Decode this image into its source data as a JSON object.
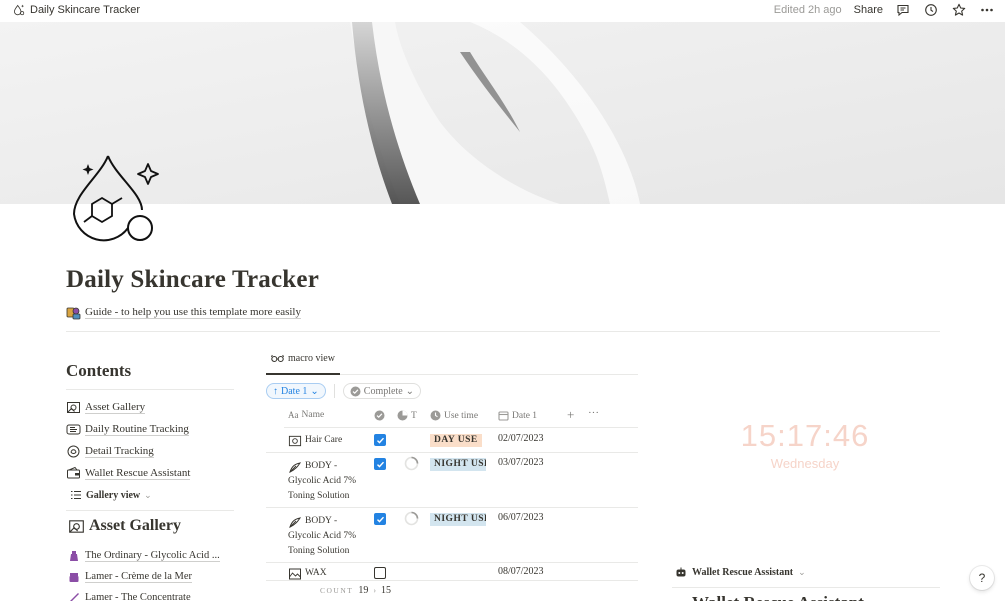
{
  "topbar": {
    "breadcrumb": "Daily Skincare Tracker",
    "edited": "Edited 2h ago",
    "share": "Share"
  },
  "page": {
    "title": "Daily Skincare Tracker",
    "guide": "Guide - to help you use this template more easily"
  },
  "contents": {
    "heading": "Contents",
    "items": [
      {
        "label": "Asset Gallery",
        "icon": "asset-gallery-icon"
      },
      {
        "label": "Daily Routine Tracking",
        "icon": "routine-icon"
      },
      {
        "label": "Detail Tracking",
        "icon": "detail-icon"
      },
      {
        "label": "Wallet Rescue Assistant",
        "icon": "wallet-icon"
      }
    ],
    "gallery_view": "Gallery view"
  },
  "asset_gallery": {
    "heading": "Asset Gallery",
    "items": [
      {
        "label": "The Ordinary - Glycolic Acid ...",
        "color": "#8b4ea6"
      },
      {
        "label": "Lamer - Crème de la Mer",
        "color": "#8b4ea6"
      },
      {
        "label": "Lamer - The Concentrate",
        "color": "#8b4ea6"
      }
    ]
  },
  "table": {
    "tab": "macro view",
    "filter_sort": "Date 1",
    "filter_complete": "Complete",
    "columns": {
      "name": "Name",
      "t": "T",
      "use_time": "Use time",
      "date": "Date 1"
    },
    "rows": [
      {
        "name_first": "Hair Care",
        "name_rest": [],
        "checked": true,
        "progress": false,
        "use": "DAY USE",
        "use_type": "day",
        "date": "02/07/2023"
      },
      {
        "name_first": "BODY -",
        "name_rest": [
          "Glycolic Acid 7%",
          "Toning Solution"
        ],
        "checked": true,
        "progress": true,
        "use": "NIGHT USE",
        "use_type": "night",
        "date": "03/07/2023"
      },
      {
        "name_first": "BODY -",
        "name_rest": [
          "Glycolic Acid 7%",
          "Toning Solution"
        ],
        "checked": true,
        "progress": true,
        "use": "NIGHT USE",
        "use_type": "night",
        "date": "06/07/2023"
      },
      {
        "name_first": "WAX",
        "name_rest": [],
        "checked": false,
        "progress": false,
        "use": "",
        "use_type": "",
        "date": "08/07/2023"
      }
    ],
    "count_label": "COUNT",
    "count_value": "19",
    "count_sub": "15"
  },
  "clock": {
    "time": "15:17:46",
    "day": "Wednesday",
    "color": "#f6d4c9"
  },
  "wallet": {
    "view_label": "Wallet Rescue Assistant",
    "heading": "Wallet Rescue Assistant"
  },
  "help": "?"
}
